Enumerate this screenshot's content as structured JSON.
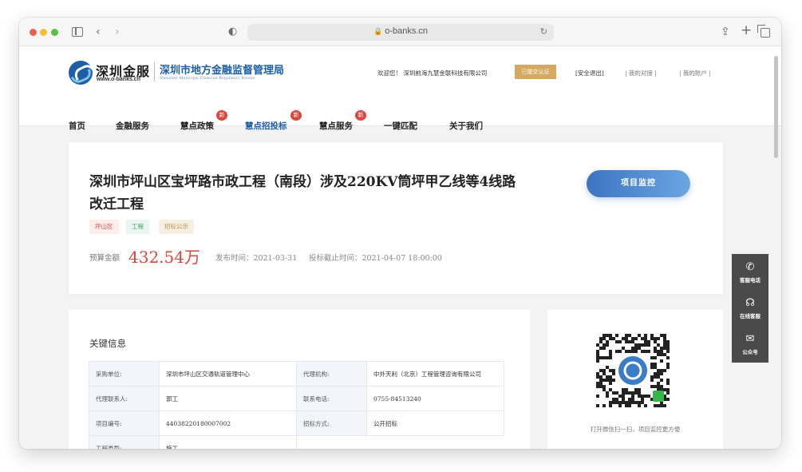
{
  "browser": {
    "url": "o-banks.cn",
    "icons": [
      "sidebar-icon",
      "back-icon",
      "forward-icon",
      "shield-icon",
      "lock-icon",
      "reload-icon",
      "share-icon",
      "plus-icon",
      "tabs-icon"
    ]
  },
  "header": {
    "logo_title": "深圳金服",
    "logo_url": "www.o-banks.cn",
    "bureau_cn": "深圳市地方金融监督管理局",
    "bureau_en": "Shenzhen Municipal Financial Regulatory Bureau",
    "welcome": "欢迎您！ 深圳前海九慧金联科技有限公司",
    "cert_button": "已提交认证",
    "logout": "[安全退出]",
    "my_dock": "| 我的对接 |",
    "my_account": "| 我的账户 |"
  },
  "nav": {
    "items": [
      {
        "label": "首页"
      },
      {
        "label": "金融服务"
      },
      {
        "label": "慧点政策",
        "badge": "新"
      },
      {
        "label": "慧点招投标",
        "badge": "新",
        "active": true
      },
      {
        "label": "慧点服务",
        "badge": "新"
      },
      {
        "label": "一键匹配"
      },
      {
        "label": "关于我们"
      }
    ]
  },
  "project": {
    "title_line1": "深圳市坪山区宝坪路市政工程（南段）涉及220KV筒坪甲乙线等4线路",
    "title_line2": "改迁工程",
    "tags": [
      "坪山区",
      "工程",
      "招标公示"
    ],
    "monitor_button": "项目监控",
    "budget_label": "预算金额",
    "budget_value": "432.54万",
    "publish_time": "发布时间：2021-03-31",
    "deadline": "投标截止时间：2021-04-07 18:00:00"
  },
  "key_info": {
    "heading": "关键信息",
    "rows": [
      {
        "l1": "采购单位:",
        "v1": "深圳市坪山区交通轨道管理中心",
        "l2": "代理机构:",
        "v2": "中外天利（北京）工程管理咨询有限公司"
      },
      {
        "l1": "代理联系人:",
        "v1": "郭工",
        "l2": "联系电话:",
        "v2": "0755-84513240"
      },
      {
        "l1": "项目编号:",
        "v1": "44038220180007002",
        "l2": "招标方式:",
        "v2": "公开招标"
      },
      {
        "l1": "工程类型:",
        "v1": "施工"
      }
    ]
  },
  "qr": {
    "caption": "打开微信扫一扫，项目监控更方便"
  },
  "side_panel": {
    "items": [
      {
        "icon": "phone-icon",
        "glyph": "✆",
        "label": "客服电话"
      },
      {
        "icon": "headset-icon",
        "glyph": "☊",
        "label": "在线客服"
      },
      {
        "icon": "wechat-icon",
        "glyph": "✉",
        "label": "公众号"
      }
    ]
  },
  "colors": {
    "brand_blue": "#1d5ea7",
    "accent_red": "#d9463e",
    "cert_gold": "#d6a960",
    "side_panel": "#4a4a4a"
  }
}
